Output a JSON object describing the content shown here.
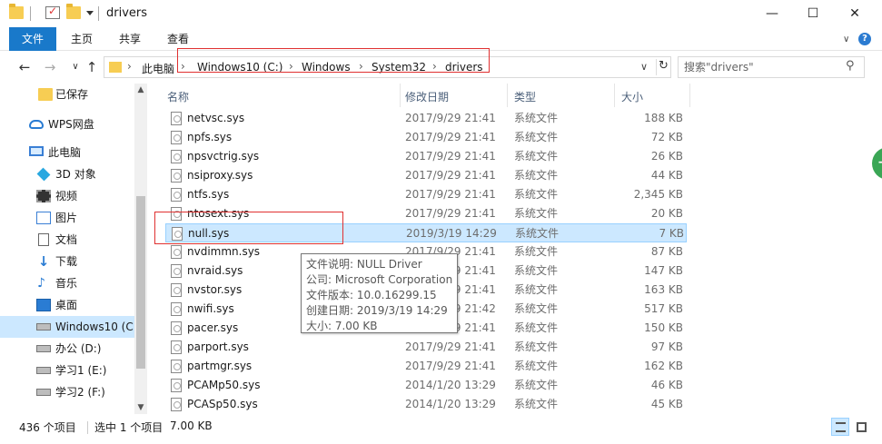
{
  "window": {
    "title": "drivers",
    "minimize": "—",
    "maximize": "☐",
    "close": "✕"
  },
  "ribbon": {
    "tabs": [
      "文件",
      "主页",
      "共享",
      "查看"
    ],
    "help": "?",
    "collapse": "∨"
  },
  "address": {
    "crumbs": [
      "此电脑",
      "Windows10 (C:)",
      "Windows",
      "System32",
      "drivers"
    ],
    "separator": "›",
    "search_placeholder": "搜索\"drivers\""
  },
  "sidebar": {
    "items": [
      {
        "label": "已保存",
        "icon": "folder-icon"
      },
      {
        "label": "WPS网盘",
        "icon": "cloud-icon"
      },
      {
        "label": "此电脑",
        "icon": "computer-icon"
      },
      {
        "label": "3D 对象",
        "icon": "cube-icon"
      },
      {
        "label": "视频",
        "icon": "video-icon"
      },
      {
        "label": "图片",
        "icon": "picture-icon"
      },
      {
        "label": "文档",
        "icon": "document-icon"
      },
      {
        "label": "下载",
        "icon": "download-icon"
      },
      {
        "label": "音乐",
        "icon": "music-icon"
      },
      {
        "label": "桌面",
        "icon": "desktop-icon"
      },
      {
        "label": "Windows10 (C:",
        "icon": "drive-icon",
        "selected": true
      },
      {
        "label": "办公 (D:)",
        "icon": "drive-icon"
      },
      {
        "label": "学习1 (E:)",
        "icon": "drive-icon"
      },
      {
        "label": "学习2 (F:)",
        "icon": "drive-icon"
      }
    ]
  },
  "columns": {
    "name": "名称",
    "date": "修改日期",
    "type": "类型",
    "size": "大小"
  },
  "files": [
    {
      "name": "netvsc.sys",
      "date": "2017/9/29 21:41",
      "type": "系统文件",
      "size": "188 KB"
    },
    {
      "name": "npfs.sys",
      "date": "2017/9/29 21:41",
      "type": "系统文件",
      "size": "72 KB"
    },
    {
      "name": "npsvctrig.sys",
      "date": "2017/9/29 21:41",
      "type": "系统文件",
      "size": "26 KB"
    },
    {
      "name": "nsiproxy.sys",
      "date": "2017/9/29 21:41",
      "type": "系统文件",
      "size": "44 KB"
    },
    {
      "name": "ntfs.sys",
      "date": "2017/9/29 21:41",
      "type": "系统文件",
      "size": "2,345 KB"
    },
    {
      "name": "ntosext.sys",
      "date": "2017/9/29 21:41",
      "type": "系统文件",
      "size": "20 KB"
    },
    {
      "name": "null.sys",
      "date": "2019/3/19 14:29",
      "type": "系统文件",
      "size": "7 KB",
      "selected": true
    },
    {
      "name": "nvdimmn.sys",
      "date": "2017/9/29 21:41",
      "type": "系统文件",
      "size": "87 KB"
    },
    {
      "name": "nvraid.sys",
      "date": "2017/9/29 21:41",
      "type": "系统文件",
      "size": "147 KB"
    },
    {
      "name": "nvstor.sys",
      "date": "2017/9/29 21:41",
      "type": "系统文件",
      "size": "163 KB"
    },
    {
      "name": "nwifi.sys",
      "date": "2017/9/29 21:42",
      "type": "系统文件",
      "size": "517 KB"
    },
    {
      "name": "pacer.sys",
      "date": "2017/9/29 21:41",
      "type": "系统文件",
      "size": "150 KB"
    },
    {
      "name": "parport.sys",
      "date": "2017/9/29 21:41",
      "type": "系统文件",
      "size": "97 KB"
    },
    {
      "name": "partmgr.sys",
      "date": "2017/9/29 21:41",
      "type": "系统文件",
      "size": "162 KB"
    },
    {
      "name": "PCAMp50.sys",
      "date": "2014/1/20 13:29",
      "type": "系统文件",
      "size": "46 KB"
    },
    {
      "name": "PCASp50.sys",
      "date": "2014/1/20 13:29",
      "type": "系统文件",
      "size": "45 KB"
    }
  ],
  "tooltip": {
    "lines": [
      "文件说明: NULL Driver",
      "公司: Microsoft Corporation",
      "文件版本: 10.0.16299.15",
      "创建日期: 2019/3/19 14:29",
      "大小: 7.00 KB"
    ]
  },
  "status": {
    "count": "436 个项目",
    "selected": "选中 1 个项目",
    "size": "7.00 KB"
  },
  "colors": {
    "accent": "#1979ca",
    "selection": "#cce8ff",
    "highlight_box": "#e03030"
  }
}
